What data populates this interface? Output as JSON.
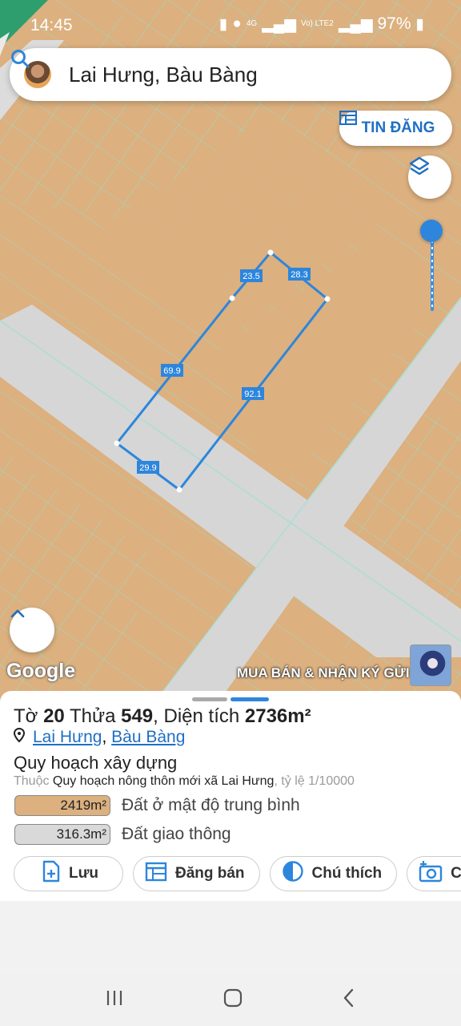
{
  "status_bar": {
    "time": "14:45",
    "network_4g": "4G",
    "network_lte": "Vo) LTE2",
    "battery": "97%"
  },
  "search": {
    "text": "Lai Hưng, Bàu Bàng"
  },
  "map": {
    "post_button_label": "TIN ĐĂNG",
    "edge_labels": [
      "23.5",
      "28.3",
      "69.9",
      "92.1",
      "29.9"
    ],
    "google_label": "Google",
    "banner_text": "MUA BÁN & NHẬN KÝ GỬI",
    "colors": {
      "land": "#dcb07f",
      "road": "#d6d6d6",
      "parcel_lines": "#7fe0d0",
      "selection": "#2d86dc"
    }
  },
  "parcel": {
    "to_label": "Tờ",
    "to_value": "20",
    "thua_label": "Thửa",
    "thua_value": "549",
    "area_label": ", Diện tích",
    "area_value": "2736m²",
    "location_ward": "Lai Hưng",
    "location_sep": ",",
    "location_district": "Bàu Bàng",
    "plan_heading": "Quy hoạch xây dựng",
    "plan_prefix": "Thuộc",
    "plan_name": "Quy hoạch nông thôn mới xã Lai Hưng",
    "plan_scale": ", tỷ lệ 1/10000",
    "land_uses": [
      {
        "area": "2419m²",
        "label": "Đất ở mật độ trung bình",
        "color": "#dcb07f"
      },
      {
        "area": "316.3m²",
        "label": "Đất giao thông",
        "color": "#d9d9d9"
      }
    ]
  },
  "actions": [
    {
      "label": "Lưu",
      "icon": "file-add-icon"
    },
    {
      "label": "Đăng bán",
      "icon": "calendar-list-icon"
    },
    {
      "label": "Chú thích",
      "icon": "contrast-icon"
    },
    {
      "label": "Chụ",
      "icon": "camera-add-icon"
    }
  ]
}
